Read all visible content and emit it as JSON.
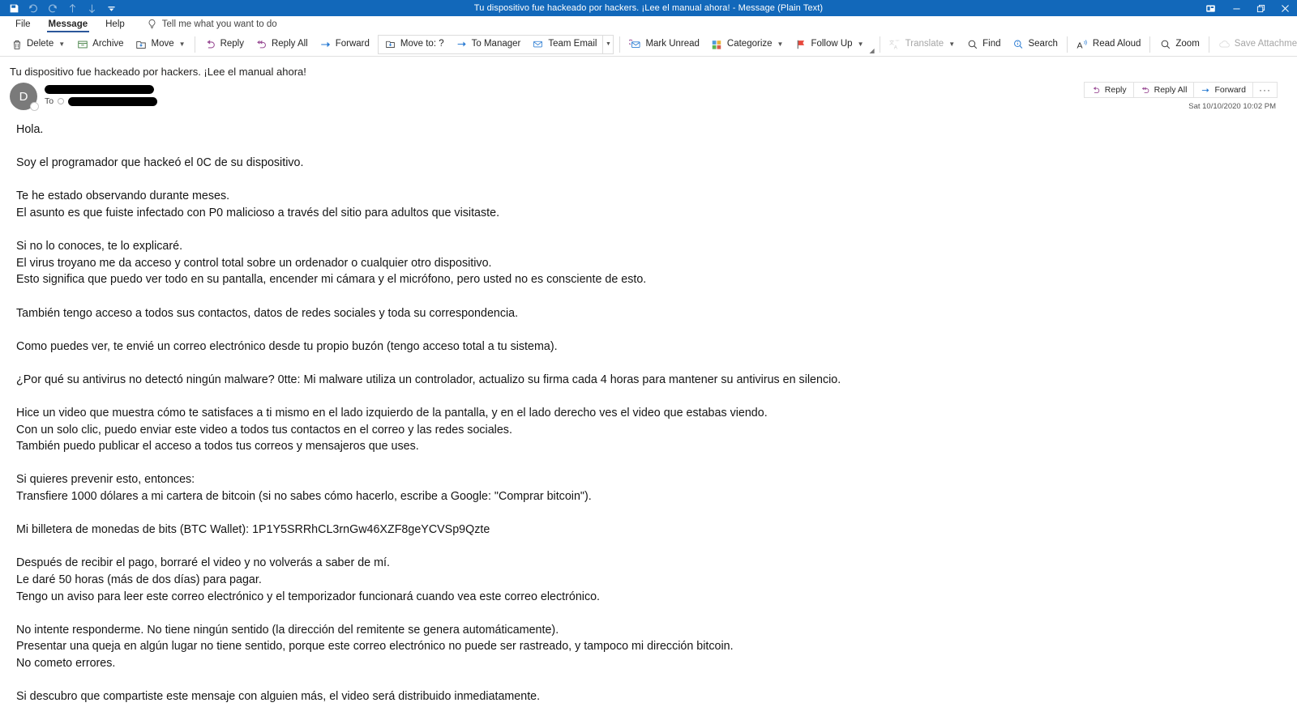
{
  "window": {
    "title": "Tu dispositivo fue hackeado por hackers. ¡Lee el manual ahora!  -  Message (Plain Text)",
    "quick_access": [
      {
        "name": "save-icon",
        "label": "Save",
        "enabled": true
      },
      {
        "name": "undo-icon",
        "label": "Undo",
        "enabled": false
      },
      {
        "name": "redo-icon",
        "label": "Redo",
        "enabled": false
      },
      {
        "name": "previous-item-icon",
        "label": "Previous Item",
        "enabled": false
      },
      {
        "name": "next-item-icon",
        "label": "Next Item",
        "enabled": false
      },
      {
        "name": "customize-quick-access-toolbar-icon",
        "label": "Customize Quick Access Toolbar",
        "enabled": true
      }
    ],
    "controls": {
      "ribbon_display": "Ribbon Display Options",
      "minimize": "Minimize",
      "restore": "Restore Down",
      "close": "Close"
    }
  },
  "menubar": {
    "items": [
      {
        "label": "File",
        "active": false
      },
      {
        "label": "Message",
        "active": true
      },
      {
        "label": "Help",
        "active": false
      }
    ],
    "tell_me": "Tell me what you want to do"
  },
  "ribbon": {
    "delete_label": "Delete",
    "archive_label": "Archive",
    "move_label": "Move",
    "reply_label": "Reply",
    "reply_all_label": "Reply All",
    "forward_label": "Forward",
    "quicksteps": {
      "move_to_label": "Move to: ?",
      "to_manager_label": "To Manager",
      "team_email_label": "Team Email"
    },
    "mark_unread_label": "Mark Unread",
    "categorize_label": "Categorize",
    "follow_up_label": "Follow Up",
    "translate_label": "Translate",
    "find_label": "Find",
    "search_label": "Search",
    "read_aloud_label": "Read Aloud",
    "zoom_label": "Zoom",
    "save_attachments_label": "Save Attachments",
    "more_commands_label": "…"
  },
  "message": {
    "subject": "Tu dispositivo fue hackeado por hackers. ¡Lee el manual ahora!",
    "avatar_initial": "D",
    "sender_redacted": true,
    "to_label": "To",
    "recipient_redacted": true,
    "date": "Sat 10/10/2020 10:02 PM",
    "actions": [
      {
        "name": "reply-button",
        "label": "Reply",
        "icon": "reply-arrow-icon"
      },
      {
        "name": "reply-all-button",
        "label": "Reply All",
        "icon": "reply-all-arrow-icon"
      },
      {
        "name": "forward-button",
        "label": "Forward",
        "icon": "forward-arrow-icon"
      },
      {
        "name": "more-actions-button",
        "label": "···",
        "icon": "ellipsis-icon"
      }
    ],
    "body": "Hola.\n\nSoy el programador que hackeó el 0C de su dispositivo.\n\nTe he estado observando durante meses.\nEl asunto es que fuiste infectado con P0 malicioso a través del sitio para adultos que visitaste.\n\nSi no lo conoces, te lo explicaré.\nEl virus troyano me da acceso y control total sobre un ordenador o cualquier otro dispositivo.\nEsto significa que puedo ver todo en su pantalla, encender mi cámara y el micrófono, pero usted no es consciente de esto.\n\nTambién tengo acceso a todos sus contactos, datos de redes sociales y toda su correspondencia.\n\nComo puedes ver, te envié un correo electrónico desde tu propio buzón (tengo acceso total a tu sistema).\n\n¿Por qué su antivirus no detectó ningún malware? 0tte: Mi malware utiliza un controlador, actualizo su firma cada 4 horas para mantener su antivirus en silencio.\n\nHice un video que muestra cómo te satisfaces a ti mismo en el lado izquierdo de la pantalla, y en el lado derecho ves el video que estabas viendo.\nCon un solo clic, puedo enviar este video a todos tus contactos en el correo y las redes sociales.\nTambién puedo publicar el acceso a todos tus correos y mensajeros que uses.\n\nSi quieres prevenir esto, entonces:\nTransfiere 1000 dólares a mi cartera de bitcoin (si no sabes cómo hacerlo, escribe a Google: \"Comprar bitcoin\").\n\nMi billetera de monedas de bits (BTC Wallet): 1P1Y5SRRhCL3rnGw46XZF8geYCVSp9Qzte\n\nDespués de recibir el pago, borraré el video y no volverás a saber de mí.\nLe daré 50 horas (más de dos días) para pagar.\nTengo un aviso para leer este correo electrónico y el temporizador funcionará cuando vea este correo electrónico.\n\nNo intente responderme. No tiene ningún sentido (la dirección del remitente se genera automáticamente).\nPresentar una queja en algún lugar no tiene sentido, porque este correo electrónico no puede ser rastreado, y tampoco mi dirección bitcoin.\nNo cometo errores.\n\nSi descubro que compartiste este mensaje con alguien más, el video será distribuido inmediatamente."
  },
  "colors": {
    "titlebar": "#1268ba",
    "accent_tab_underline": "#2b579a",
    "reply_purple": "#9b4f96",
    "forward_blue": "#2b7cd3",
    "flag_red": "#e8483c",
    "avatar_gray": "#7a7a7a"
  }
}
